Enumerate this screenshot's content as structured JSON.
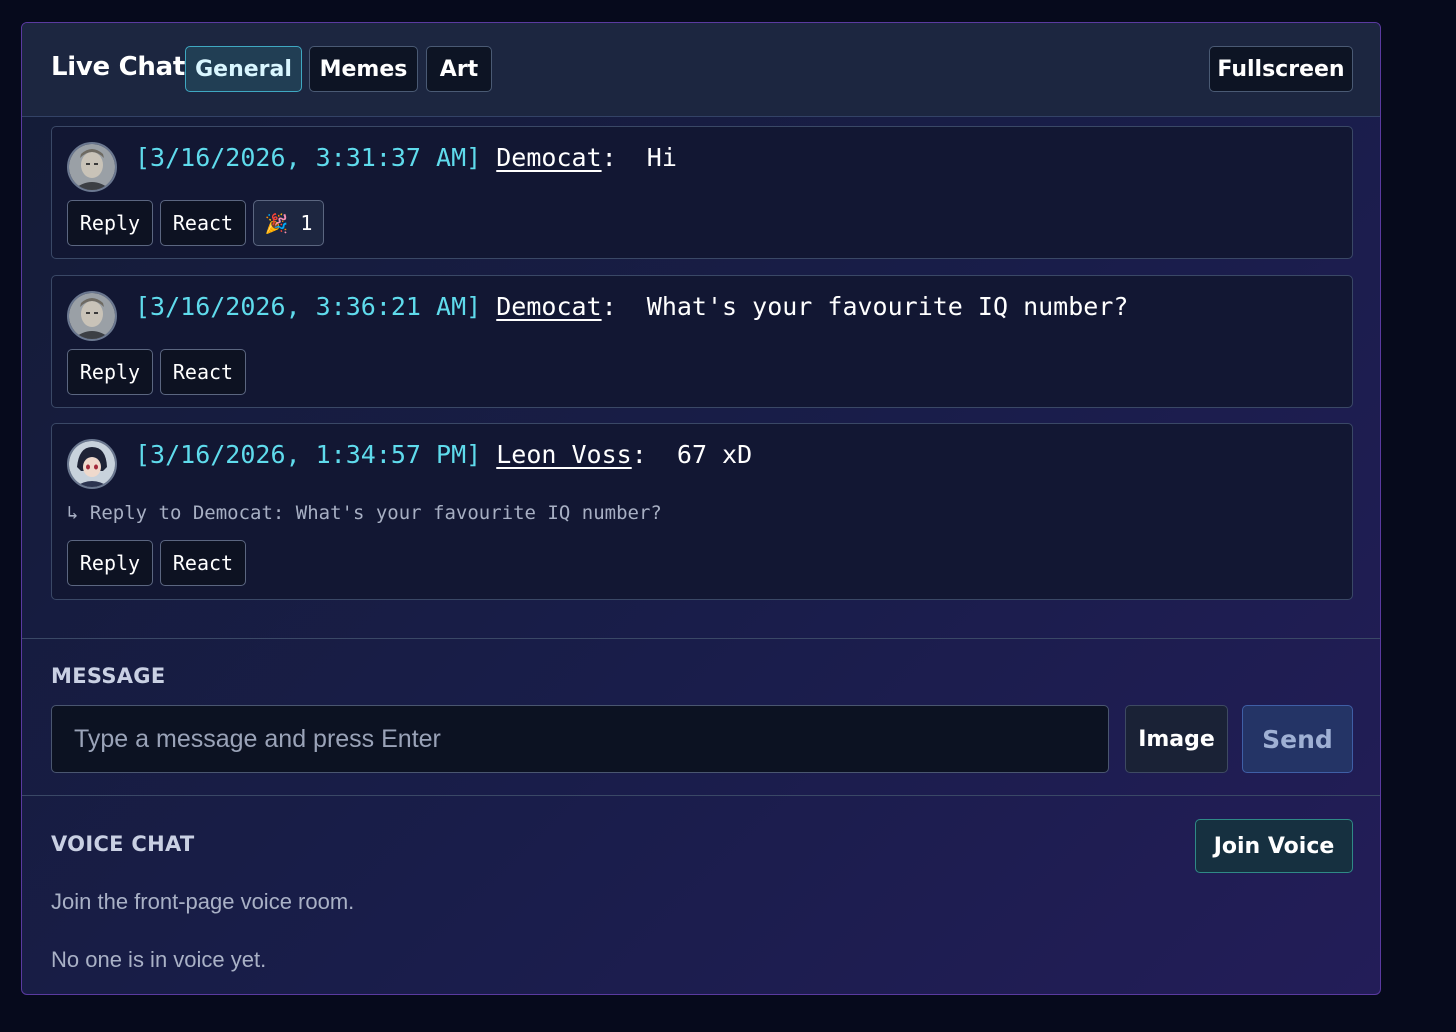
{
  "header": {
    "title": "Live Chat",
    "tabs": [
      {
        "label": "General",
        "active": true
      },
      {
        "label": "Memes",
        "active": false
      },
      {
        "label": "Art",
        "active": false
      }
    ],
    "fullscreen_label": "Fullscreen"
  },
  "messages": [
    {
      "timestamp": "[3/16/2026, 3:31:37 AM]",
      "user": "Democat",
      "separator": ":",
      "text": "Hi",
      "avatar": "man-portrait-avatar",
      "reply_to": null,
      "reply_label": "Reply",
      "react_label": "React",
      "reactions": [
        {
          "emoji": "🎉",
          "count": "1"
        }
      ]
    },
    {
      "timestamp": "[3/16/2026, 3:36:21 AM]",
      "user": "Democat",
      "separator": ":",
      "text": "What's your favourite IQ number?",
      "avatar": "man-portrait-avatar",
      "reply_to": null,
      "reply_label": "Reply",
      "react_label": "React",
      "reactions": []
    },
    {
      "timestamp": "[3/16/2026, 1:34:57 PM]",
      "user": "Leon Voss",
      "separator": ":",
      "text": "67 xD",
      "avatar": "anime-character-avatar",
      "reply_to": "↳ Reply to Democat: What's your favourite IQ number?",
      "reply_label": "Reply",
      "react_label": "React",
      "reactions": []
    }
  ],
  "compose": {
    "label": "MESSAGE",
    "placeholder": "Type a message and press Enter",
    "image_label": "Image",
    "send_label": "Send"
  },
  "voice": {
    "label": "VOICE CHAT",
    "join_label": "Join Voice",
    "description": "Join the front-page voice room.",
    "status": "No one is in voice yet."
  },
  "colors": {
    "accent_cyan": "#5fdbec",
    "active_tab_border": "#3fa8c2",
    "panel_border": "#5a3aa0",
    "join_voice_border": "#2f8a86"
  }
}
